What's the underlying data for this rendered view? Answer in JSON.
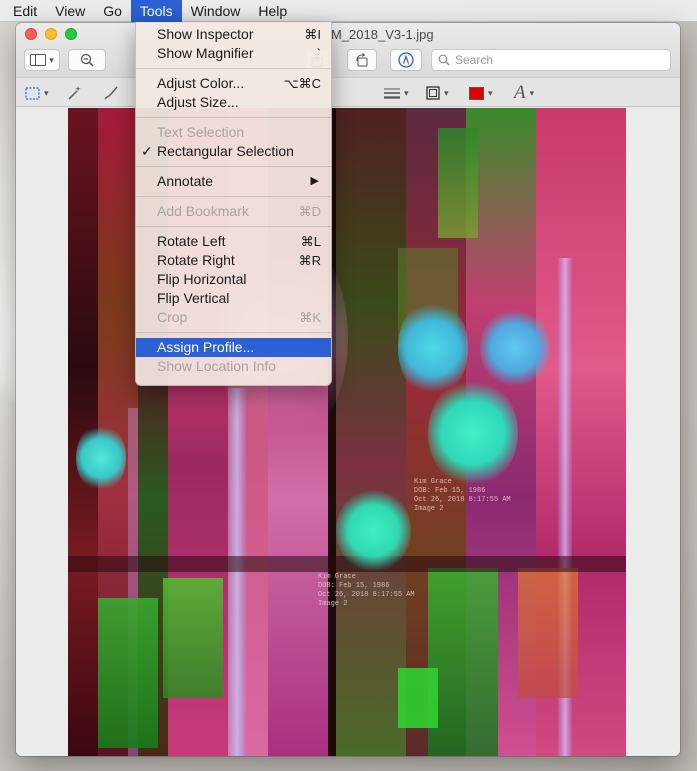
{
  "menubar": {
    "items": [
      "Edit",
      "View",
      "Go",
      "Tools",
      "Window",
      "Help"
    ],
    "active_index": 3
  },
  "window": {
    "title": "M_2018_V3-1.jpg"
  },
  "toolbar": {
    "search_placeholder": "Search"
  },
  "tools_menu": {
    "show_inspector": {
      "label": "Show Inspector",
      "shortcut": "⌘I"
    },
    "show_magnifier": {
      "label": "Show Magnifier",
      "shortcut": "`"
    },
    "adjust_color": {
      "label": "Adjust Color...",
      "shortcut": "⌥⌘C"
    },
    "adjust_size": {
      "label": "Adjust Size..."
    },
    "text_selection": {
      "label": "Text Selection"
    },
    "rectangular_selection": {
      "label": "Rectangular Selection",
      "check": "✓"
    },
    "annotate": {
      "label": "Annotate",
      "arrow": "▶"
    },
    "add_bookmark": {
      "label": "Add Bookmark",
      "shortcut": "⌘D"
    },
    "rotate_left": {
      "label": "Rotate Left",
      "shortcut": "⌘L"
    },
    "rotate_right": {
      "label": "Rotate Right",
      "shortcut": "⌘R"
    },
    "flip_horizontal": {
      "label": "Flip Horizontal"
    },
    "flip_vertical": {
      "label": "Flip Vertical"
    },
    "crop": {
      "label": "Crop",
      "shortcut": "⌘K"
    },
    "assign_profile": {
      "label": "Assign Profile..."
    },
    "show_location_info": {
      "label": "Show Location Info"
    }
  },
  "image_text": {
    "block1": "Kim Grace\nDOB: Feb 15, 1986\nOct 26, 2018 8:17:55 AM\nImage 2",
    "block2": "Kim Grace\nDOB: Feb 15, 1986\nOct 26, 2018 8:17:55 AM\nImage 2"
  },
  "colors": {
    "accent": "#2c61d6",
    "markup_color_swatch": "#e00000"
  }
}
